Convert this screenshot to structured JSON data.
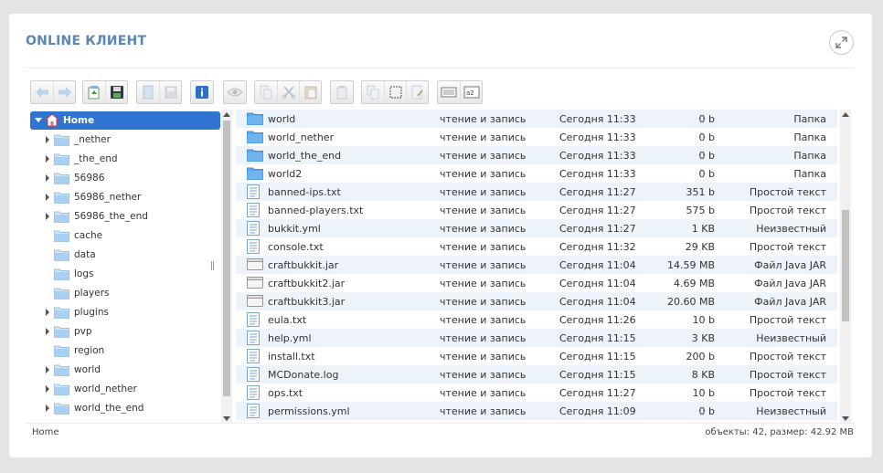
{
  "panel": {
    "title": "ONLINE КЛИЕНТ"
  },
  "tree": {
    "root": "Home",
    "items": [
      {
        "label": "_nether",
        "expandable": true
      },
      {
        "label": "_the_end",
        "expandable": true
      },
      {
        "label": "56986",
        "expandable": true
      },
      {
        "label": "56986_nether",
        "expandable": true
      },
      {
        "label": "56986_the_end",
        "expandable": true
      },
      {
        "label": "cache",
        "expandable": false
      },
      {
        "label": "data",
        "expandable": false
      },
      {
        "label": "logs",
        "expandable": false
      },
      {
        "label": "players",
        "expandable": false
      },
      {
        "label": "plugins",
        "expandable": true
      },
      {
        "label": "pvp",
        "expandable": true
      },
      {
        "label": "region",
        "expandable": false
      },
      {
        "label": "world",
        "expandable": true
      },
      {
        "label": "world_nether",
        "expandable": true
      },
      {
        "label": "world_the_end",
        "expandable": true
      }
    ]
  },
  "files": [
    {
      "name": "world",
      "perm": "чтение и запись",
      "date": "Сегодня 11:33",
      "size": "0 b",
      "type": "Папка",
      "icon": "folder"
    },
    {
      "name": "world_nether",
      "perm": "чтение и запись",
      "date": "Сегодня 11:33",
      "size": "0 b",
      "type": "Папка",
      "icon": "folder"
    },
    {
      "name": "world_the_end",
      "perm": "чтение и запись",
      "date": "Сегодня 11:33",
      "size": "0 b",
      "type": "Папка",
      "icon": "folder"
    },
    {
      "name": "world2",
      "perm": "чтение и запись",
      "date": "Сегодня 11:33",
      "size": "0 b",
      "type": "Папка",
      "icon": "folder"
    },
    {
      "name": "banned-ips.txt",
      "perm": "чтение и запись",
      "date": "Сегодня 11:27",
      "size": "351 b",
      "type": "Простой текст",
      "icon": "text"
    },
    {
      "name": "banned-players.txt",
      "perm": "чтение и запись",
      "date": "Сегодня 11:27",
      "size": "575 b",
      "type": "Простой текст",
      "icon": "text"
    },
    {
      "name": "bukkit.yml",
      "perm": "чтение и запись",
      "date": "Сегодня 11:27",
      "size": "1 KB",
      "type": "Неизвестный",
      "icon": "text"
    },
    {
      "name": "console.txt",
      "perm": "чтение и запись",
      "date": "Сегодня 11:32",
      "size": "29 KB",
      "type": "Простой текст",
      "icon": "text"
    },
    {
      "name": "craftbukkit.jar",
      "perm": "чтение и запись",
      "date": "Сегодня 11:04",
      "size": "14.59 MB",
      "type": "Файл Java JAR",
      "icon": "jar"
    },
    {
      "name": "craftbukkit2.jar",
      "perm": "чтение и запись",
      "date": "Сегодня 11:04",
      "size": "4.69 MB",
      "type": "Файл Java JAR",
      "icon": "jar"
    },
    {
      "name": "craftbukkit3.jar",
      "perm": "чтение и запись",
      "date": "Сегодня 11:04",
      "size": "20.60 MB",
      "type": "Файл Java JAR",
      "icon": "jar"
    },
    {
      "name": "eula.txt",
      "perm": "чтение и запись",
      "date": "Сегодня 11:26",
      "size": "10 b",
      "type": "Простой текст",
      "icon": "text"
    },
    {
      "name": "help.yml",
      "perm": "чтение и запись",
      "date": "Сегодня 11:15",
      "size": "3 KB",
      "type": "Неизвестный",
      "icon": "text"
    },
    {
      "name": "install.txt",
      "perm": "чтение и запись",
      "date": "Сегодня 11:15",
      "size": "200 b",
      "type": "Простой текст",
      "icon": "text"
    },
    {
      "name": "MCDonate.log",
      "perm": "чтение и запись",
      "date": "Сегодня 11:15",
      "size": "8 KB",
      "type": "Простой текст",
      "icon": "text"
    },
    {
      "name": "ops.txt",
      "perm": "чтение и запись",
      "date": "Сегодня 11:27",
      "size": "10 b",
      "type": "Простой текст",
      "icon": "text"
    },
    {
      "name": "permissions.yml",
      "perm": "чтение и запись",
      "date": "Сегодня 11:09",
      "size": "0 b",
      "type": "Неизвестный",
      "icon": "text"
    }
  ],
  "status": {
    "path": "Home",
    "info": "объекты: 42, размер: 42.92 MB"
  },
  "colors": {
    "title": "#5b86b4",
    "selection": "#2f74d0",
    "row_alt": "#edf3fb",
    "folder": "#5fa8e8"
  }
}
